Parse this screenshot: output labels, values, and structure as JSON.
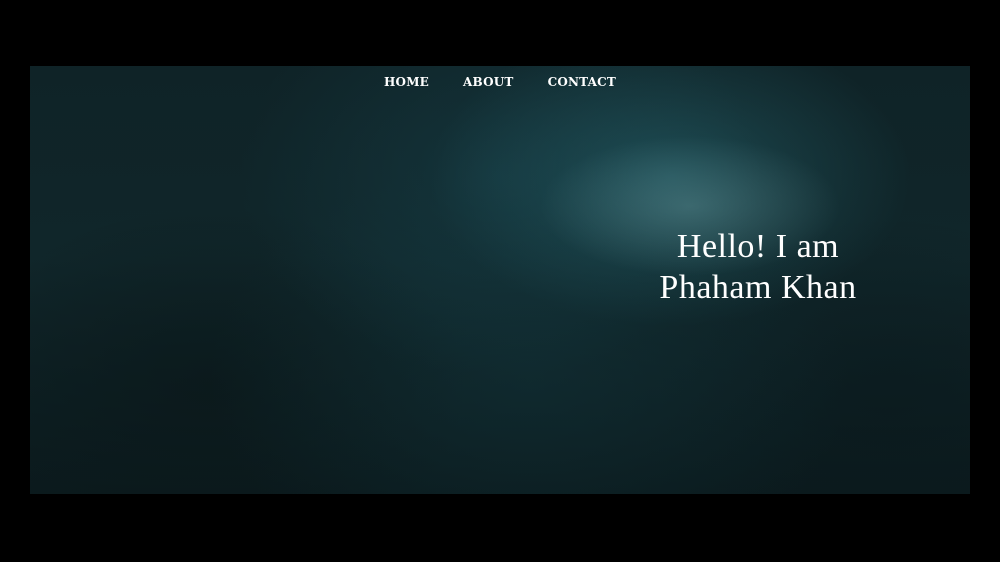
{
  "nav": {
    "items": [
      {
        "label": "HOME"
      },
      {
        "label": "ABOUT"
      },
      {
        "label": "CONTACT"
      }
    ]
  },
  "hero": {
    "line1": "Hello! I am",
    "line2": "Phaham Khan"
  },
  "colors": {
    "page_background": "#000000",
    "hero_background": "#10262a",
    "text": "#ffffff"
  }
}
